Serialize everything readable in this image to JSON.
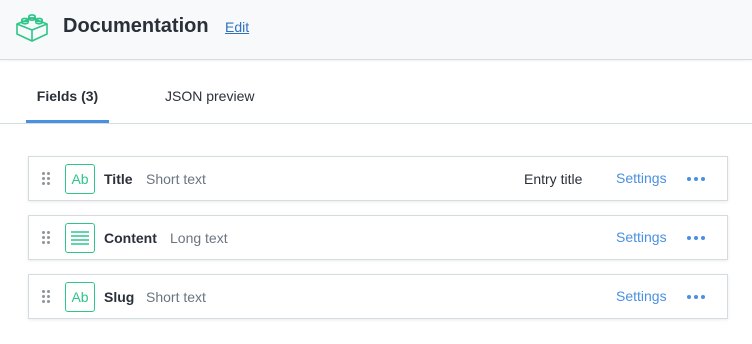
{
  "header": {
    "icon": "content-type-blocks-icon",
    "title": "Documentation",
    "edit_label": "Edit"
  },
  "tabs": [
    {
      "label": "Fields (3)",
      "active": true
    },
    {
      "label": "JSON preview",
      "active": false
    }
  ],
  "fields": [
    {
      "icon": "Ab",
      "name": "Title",
      "type": "Short text",
      "entry_title": "Entry title",
      "settings_label": "Settings"
    },
    {
      "icon": "long-text-icon",
      "name": "Content",
      "type": "Long text",
      "settings_label": "Settings"
    },
    {
      "icon": "Ab",
      "name": "Slug",
      "type": "Short text",
      "settings_label": "Settings"
    }
  ],
  "colors": {
    "accent": "#4a90e2",
    "field_icon": "#2ec58a",
    "header_bg": "#f7f9fa"
  }
}
